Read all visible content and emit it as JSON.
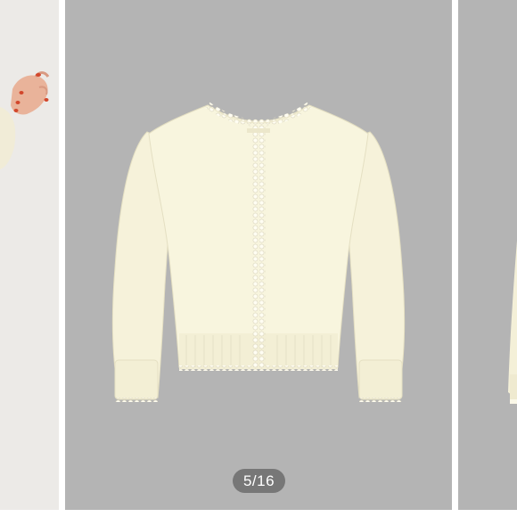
{
  "carousel": {
    "counter_text": "5/16",
    "current_index": 5,
    "total": 16
  },
  "slides": {
    "previous": {
      "subject": "person-holding-sleeve",
      "background": "#ece9e6"
    },
    "current": {
      "subject": "cream-pearl-trim-cardigan",
      "background": "#b4b4b4",
      "garment_color": "#f7f4dd"
    },
    "next": {
      "subject": "cream-cardigan-edge",
      "background": "#b4b4b4"
    }
  }
}
